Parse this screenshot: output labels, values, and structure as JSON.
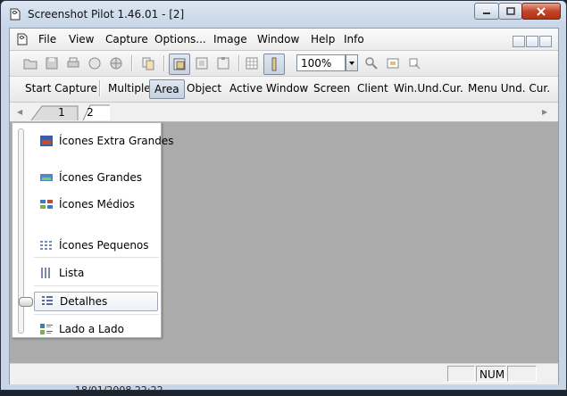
{
  "window": {
    "title": "Screenshot Pilot 1.46.01 - [2]",
    "title_buttons": [
      "minimize",
      "maximize",
      "close"
    ]
  },
  "menu": {
    "items": [
      "File",
      "View",
      "Capture",
      "Options...",
      "Image",
      "Window",
      "Help",
      "Info"
    ]
  },
  "toolbar": {
    "zoom_value": "100%"
  },
  "capture_bar": {
    "buttons": [
      "Start Capture",
      "Multiple",
      "Area",
      "Object",
      "Active Window",
      "Screen",
      "Client",
      "Win.Und.Cur.",
      "Menu Und. Cur."
    ],
    "active": "Area"
  },
  "tabs": {
    "items": [
      "1",
      "2"
    ],
    "active": "2"
  },
  "view_menu": {
    "items": [
      {
        "label": "Ícones Extra Grandes",
        "icon": "extra-large-icons-icon"
      },
      {
        "label": "Ícones Grandes",
        "icon": "large-icons-icon"
      },
      {
        "label": "Ícones Médios",
        "icon": "medium-icons-icon"
      },
      {
        "label": "Ícones Pequenos",
        "icon": "small-icons-icon"
      },
      {
        "label": "Lista",
        "icon": "list-icon"
      },
      {
        "label": "Detalhes",
        "icon": "details-icon"
      },
      {
        "label": "Lado a Lado",
        "icon": "tiles-icon"
      }
    ],
    "selected": "Detalhes"
  },
  "status": {
    "num_label": "NUM"
  },
  "background": {
    "partial_date_text": "18/01/2008 22:22"
  },
  "colors": {
    "workspace": "#ababab",
    "title_gradient": "#c7d5e6",
    "close_button": "#c2452a"
  }
}
